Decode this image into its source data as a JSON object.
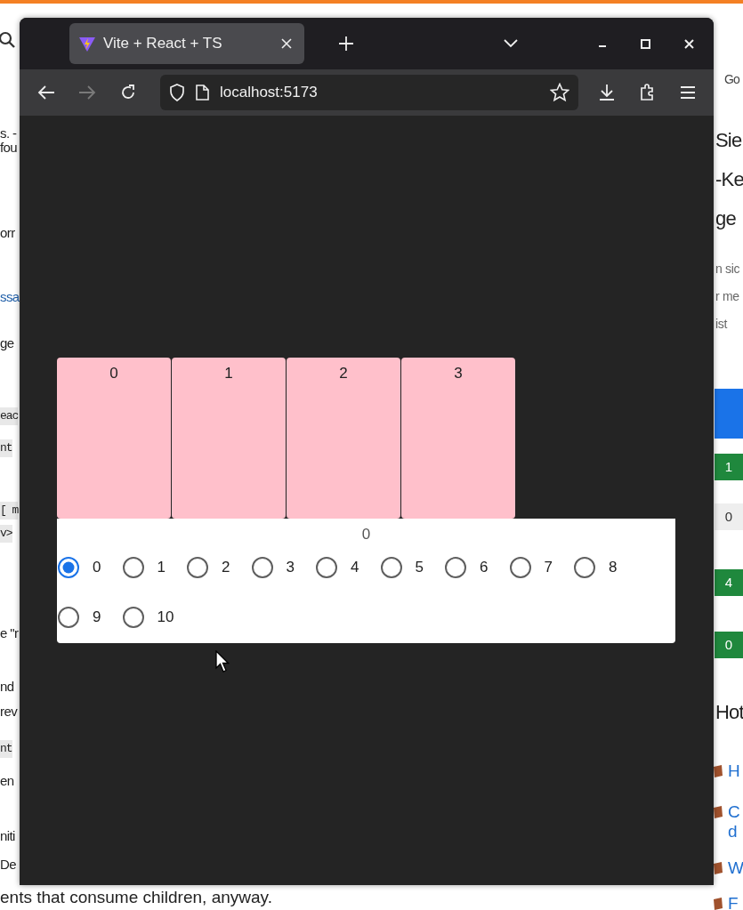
{
  "background_page": {
    "left_fragments": [
      {
        "text": "s. -",
        "kind": "text"
      },
      {
        "text": "fou",
        "kind": "text"
      },
      {
        "text": "orr",
        "kind": "text"
      },
      {
        "text": "ssa",
        "kind": "link"
      },
      {
        "text": "ge",
        "kind": "text"
      },
      {
        "text": "eac",
        "kind": "code"
      },
      {
        "text": "nt",
        "kind": "code"
      },
      {
        "text": "[ m",
        "kind": "code"
      },
      {
        "text": "v>",
        "kind": "code"
      },
      {
        "text": "e \"r",
        "kind": "text"
      },
      {
        "text": "nd",
        "kind": "text"
      },
      {
        "text": "rev",
        "kind": "text"
      },
      {
        "text": "nt",
        "kind": "code"
      },
      {
        "text": "en",
        "kind": "text"
      },
      {
        "text": "niti",
        "kind": "text"
      },
      {
        "text": "De",
        "kind": "text"
      }
    ],
    "right_fragments": [
      {
        "text": "Go",
        "kind": "tab"
      },
      {
        "text": "Sie",
        "kind": "heading"
      },
      {
        "text": "-Ke",
        "kind": "heading"
      },
      {
        "text": "ge",
        "kind": "heading"
      },
      {
        "text": "n sic",
        "kind": "text"
      },
      {
        "text": "r me",
        "kind": "text"
      },
      {
        "text": "ist",
        "kind": "text"
      },
      {
        "kind": "banner"
      },
      {
        "text": "1",
        "kind": "badge",
        "color": "#1f883d"
      },
      {
        "text": "0",
        "kind": "badge",
        "color": "#eeeeee"
      },
      {
        "text": "4",
        "kind": "badge",
        "color": "#1f883d"
      },
      {
        "text": "0",
        "kind": "badge",
        "color": "#1f883d"
      },
      {
        "text": "Hot",
        "kind": "heading"
      },
      {
        "text": "H",
        "kind": "link"
      },
      {
        "text": "C",
        "kind": "link"
      },
      {
        "text": "d",
        "kind": "link"
      },
      {
        "text": "W",
        "kind": "link"
      },
      {
        "text": "F",
        "kind": "link"
      }
    ],
    "bottom_text": "ents that consume children, anyway."
  },
  "browser": {
    "tab": {
      "title": "Vite + React + TS",
      "selected": true
    },
    "nav_buttons": [
      {
        "kind": "back",
        "disabled": false
      },
      {
        "kind": "forward",
        "disabled": true
      },
      {
        "kind": "reload",
        "disabled": false
      }
    ],
    "url": "localhost:5173",
    "app": {
      "cards": [
        {
          "label": "0"
        },
        {
          "label": "1"
        },
        {
          "label": "2"
        },
        {
          "label": "3"
        }
      ],
      "value": "0",
      "options": [
        {
          "label": "0",
          "selected": true
        },
        {
          "label": "1",
          "selected": false
        },
        {
          "label": "2",
          "selected": false
        },
        {
          "label": "3",
          "selected": false
        },
        {
          "label": "4",
          "selected": false
        },
        {
          "label": "5",
          "selected": false
        },
        {
          "label": "6",
          "selected": false
        },
        {
          "label": "7",
          "selected": false
        },
        {
          "label": "8",
          "selected": false
        },
        {
          "label": "9",
          "selected": false
        },
        {
          "label": "10",
          "selected": false
        }
      ]
    }
  }
}
